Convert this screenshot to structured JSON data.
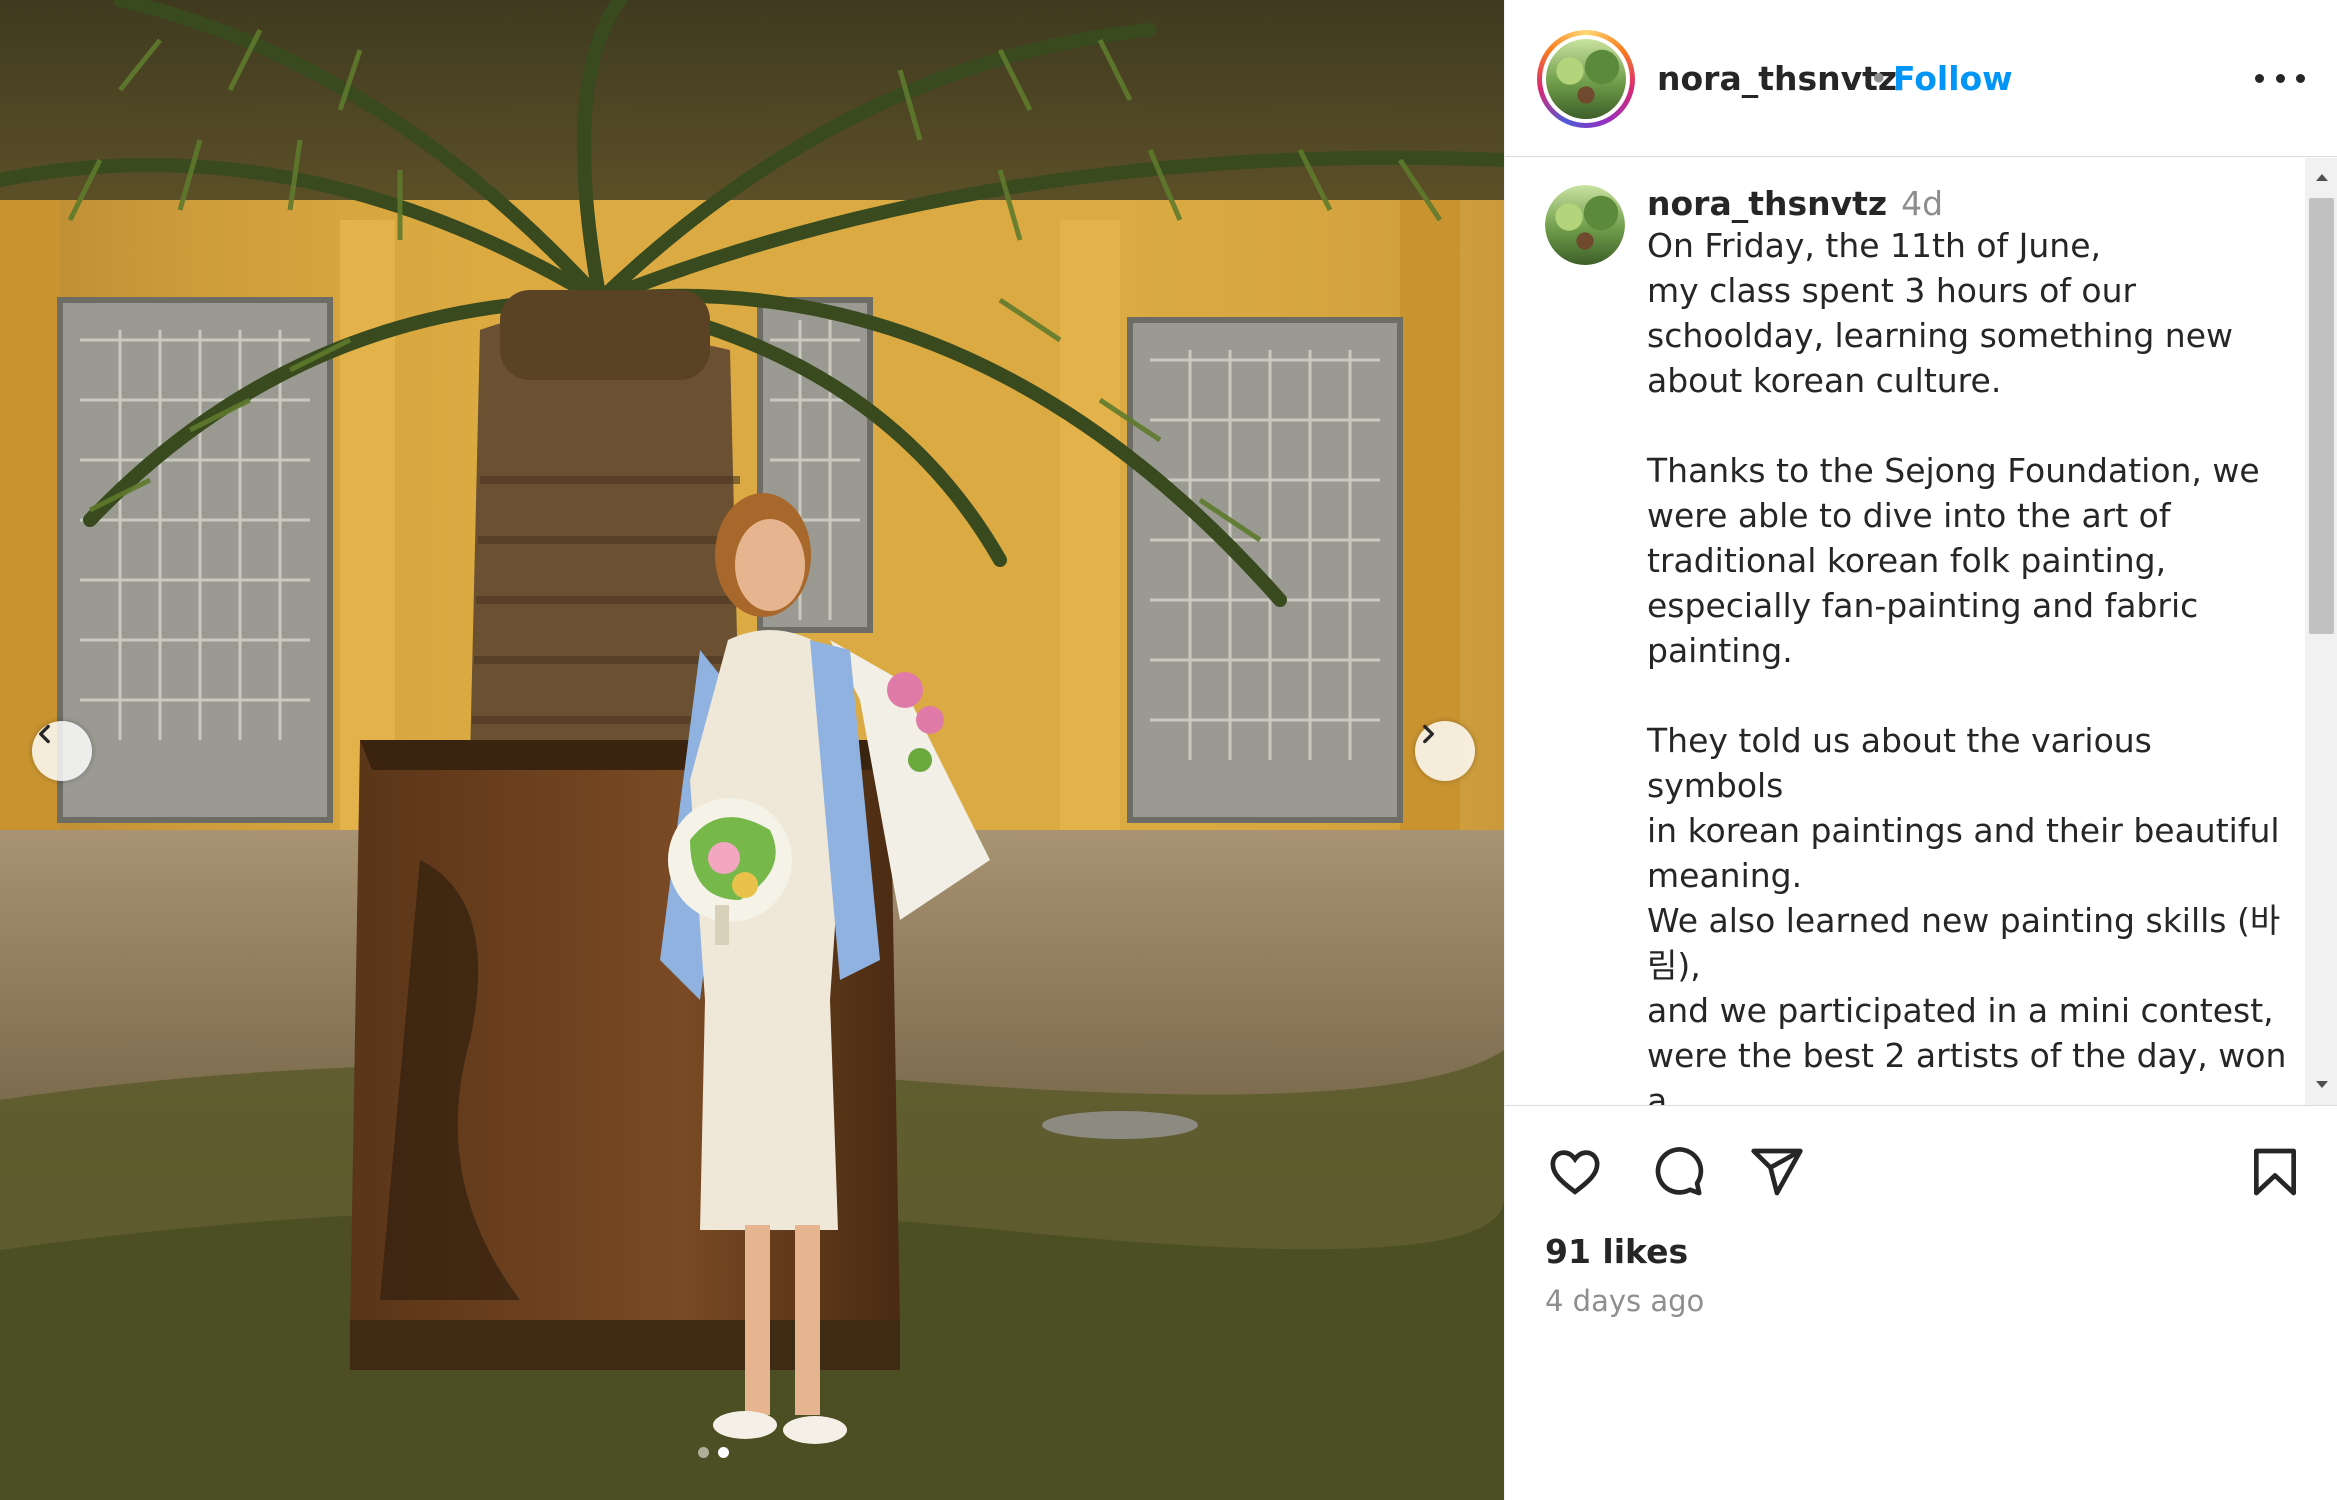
{
  "post": {
    "username": "nora_thsnvtz",
    "separator": "•",
    "follow_label": "Follow",
    "more_icon": "more-horizontal-icon"
  },
  "caption": {
    "username": "nora_thsnvtz",
    "time": "4d",
    "text": "On Friday, the 11th of June,\nmy class spent 3 hours of our\nschoolday, learning something new\nabout korean culture.\n\nThanks to the Sejong Foundation, we\nwere able to dive into the art of\ntraditional korean folk painting,\nespecially fan-painting and fabric\npainting.\n\nThey told us about the various symbols\nin korean paintings and their beautiful\nmeaning.\nWe also learned new painting skills (바\n림),\nand we participated in a mini contest,\nwere the best 2 artists of the day, won a\nhand painted accessory."
  },
  "actions": {
    "icons": [
      "heart-icon",
      "comment-icon",
      "share-icon",
      "bookmark-icon"
    ],
    "likes": "91 likes",
    "timestamp": "4 days ago"
  },
  "carousel": {
    "prev_icon": "chevron-left-icon",
    "next_icon": "chevron-right-icon",
    "slide_count": 2,
    "active_slide": 2
  },
  "colors": {
    "follow": "#0095f6",
    "secondary_text": "#8e8e8e",
    "primary_text": "#262626"
  }
}
